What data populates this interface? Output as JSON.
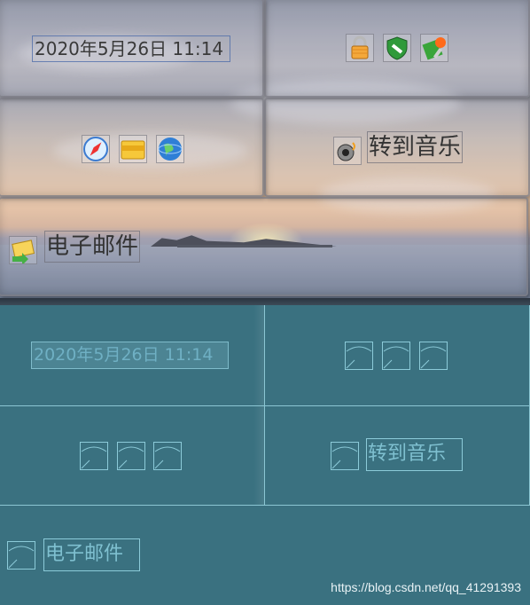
{
  "runtime": {
    "datetime": "2020年5月26日 11:14",
    "music_label": "转到音乐",
    "email_label": "电子邮件",
    "icons_row1": [
      "lock-icon",
      "shield-icon",
      "settings-tool-icon"
    ],
    "icons_row2": [
      "safari-compass-icon",
      "folder-icon",
      "globe-icon"
    ],
    "music_icon": "speaker-music-icon",
    "email_icon": "mail-arrow-icon"
  },
  "designer": {
    "datetime": "2020年5月26日 11:14",
    "music_label": "转到音乐",
    "email_label": "电子邮件",
    "placeholder_icon": "image-placeholder-icon"
  },
  "watermark": "https://blog.csdn.net/qq_41291393",
  "colors": {
    "designer_bg": "#3a7180",
    "designer_line": "#8bc6d3",
    "designer_text": "#7fc0d0"
  }
}
